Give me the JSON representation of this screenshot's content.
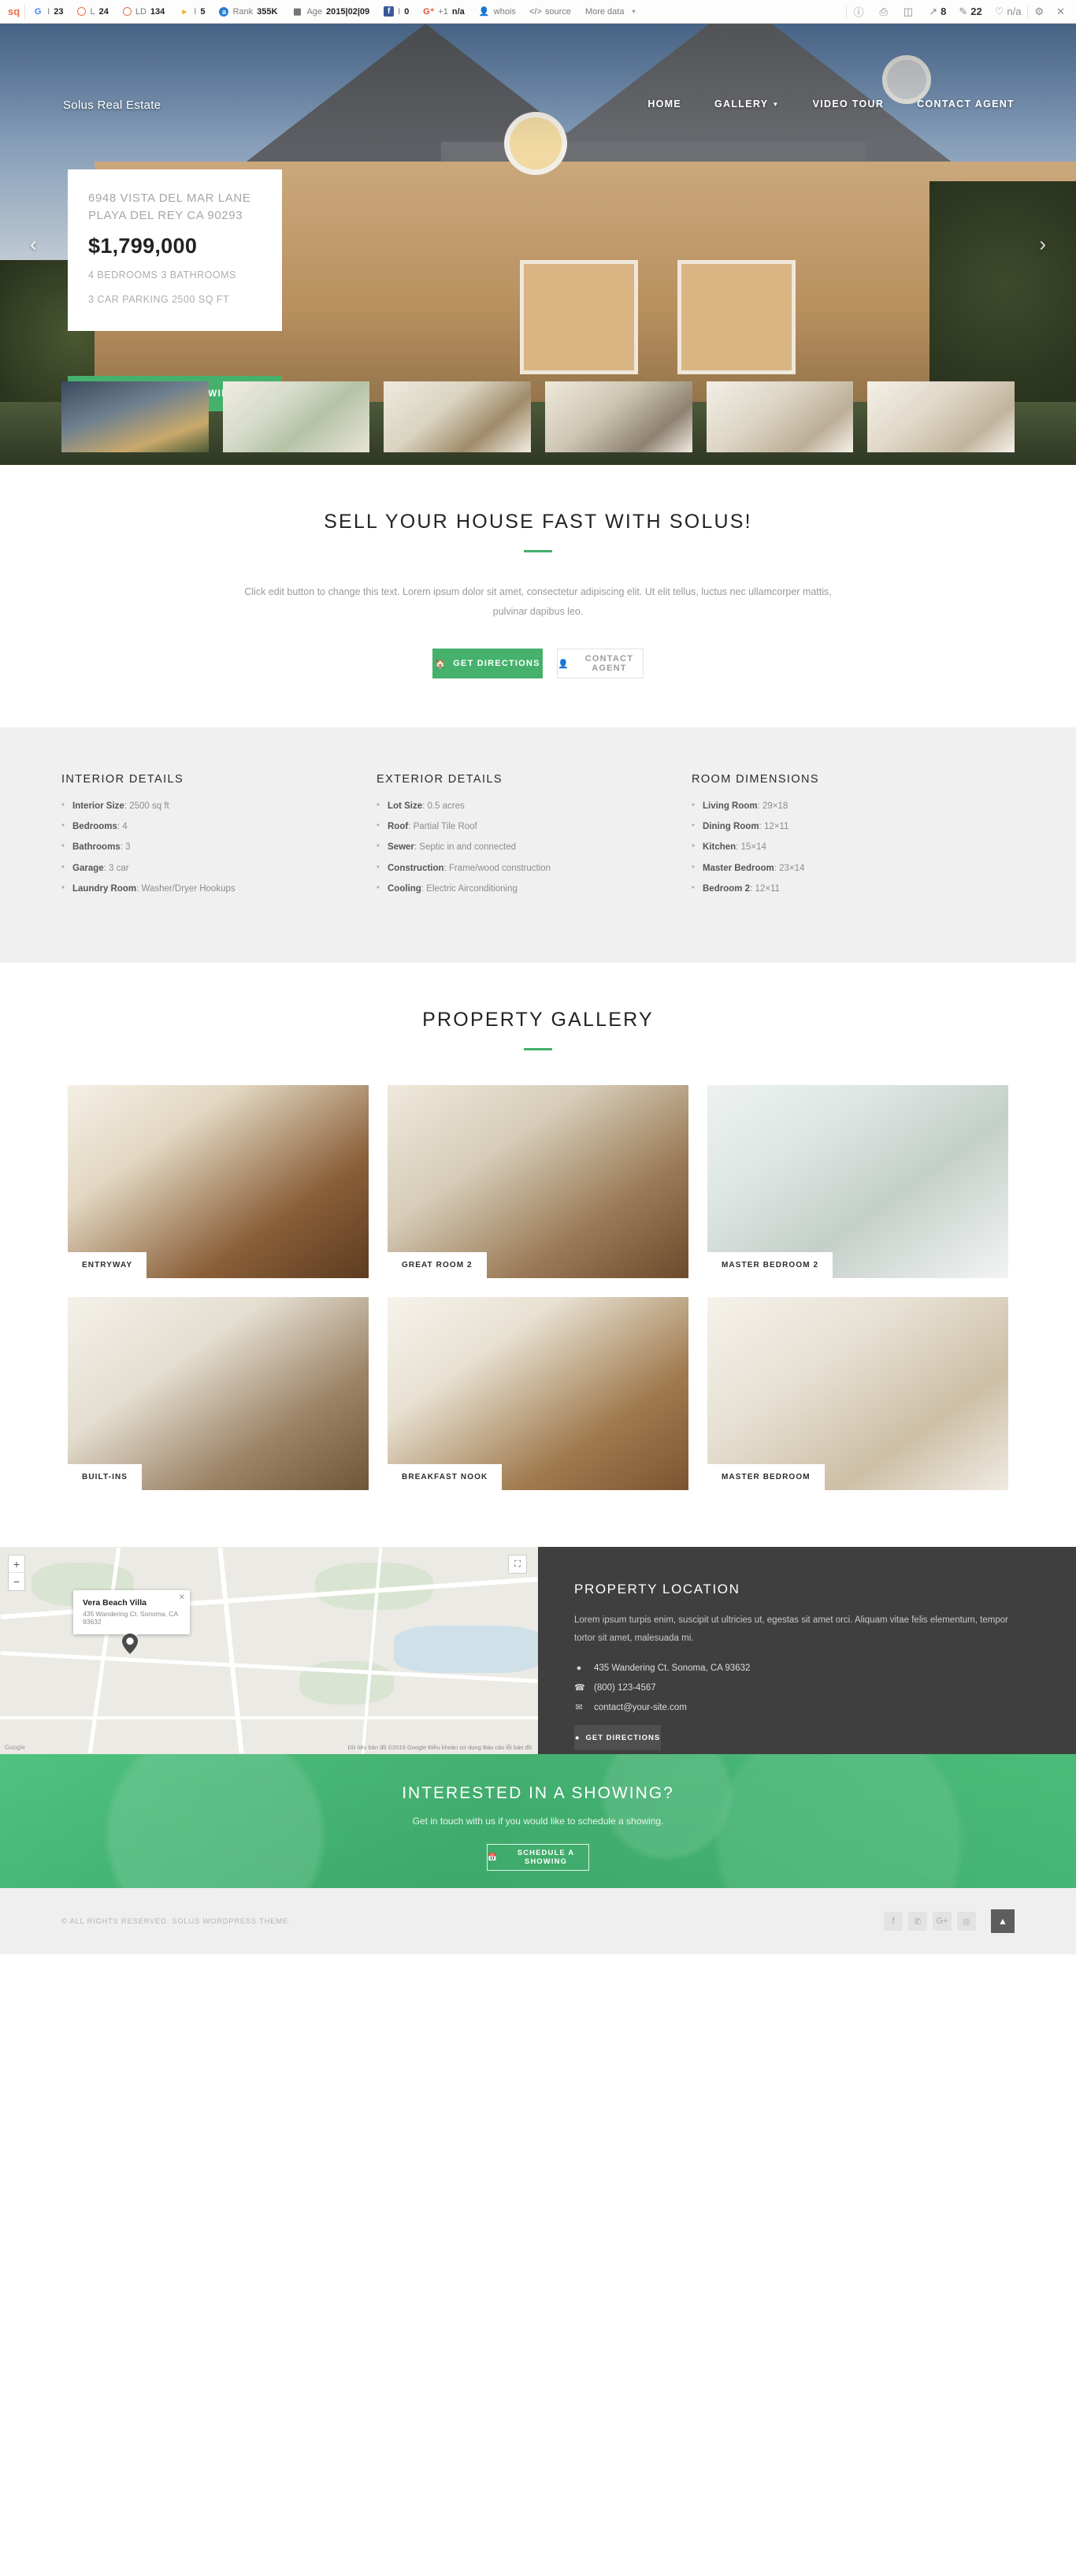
{
  "seobar": {
    "brand": "sq",
    "metrics": [
      {
        "icon": "google-icon",
        "label": "I",
        "value": "23"
      },
      {
        "icon": "moz-icon",
        "label": "L",
        "value": "24"
      },
      {
        "icon": "moz-ld-icon",
        "label": "LD",
        "value": "134"
      },
      {
        "icon": "yandex-icon",
        "label": "I",
        "value": "5"
      },
      {
        "icon": "alexa-icon",
        "label": "Rank",
        "value": "355K"
      },
      {
        "icon": "archive-icon",
        "label": "Age",
        "value": "2015|02|09"
      },
      {
        "icon": "facebook-icon",
        "label": "I",
        "value": "0"
      },
      {
        "icon": "googleplus-icon",
        "label": "+1",
        "value": "n/a"
      }
    ],
    "links": [
      {
        "icon": "person-icon",
        "label": "whois"
      },
      {
        "icon": "code-icon",
        "label": "source"
      },
      {
        "icon": "chevron-down-icon",
        "label": "More data"
      }
    ],
    "right_tools": [
      {
        "icon": "info-icon",
        "value": ""
      },
      {
        "icon": "highlight-icon",
        "value": ""
      },
      {
        "icon": "page-icon",
        "value": ""
      },
      {
        "icon": "external-link-icon",
        "value": "8"
      },
      {
        "icon": "internal-link-icon",
        "value": "22"
      },
      {
        "icon": "health-icon",
        "value": "n/a"
      }
    ],
    "settings_icon": "gear-icon",
    "close_icon": "close-icon"
  },
  "hero": {
    "brand": "Solus Real Estate",
    "nav": [
      {
        "label": "HOME",
        "has_caret": false
      },
      {
        "label": "GALLERY",
        "has_caret": true
      },
      {
        "label": "VIDEO TOUR",
        "has_caret": false
      },
      {
        "label": "CONTACT AGENT",
        "has_caret": false
      }
    ],
    "card": {
      "address_line1": "6948 VISTA DEL MAR LANE",
      "address_line2": "PLAYA DEL REY CA 90293",
      "price": "$1,799,000",
      "specs_line1": "4 BEDROOMS 3 BATHROOMS",
      "specs_line2": "3 CAR PARKING 2500 SQ FT"
    },
    "cta_label": "SCHEDULE A SHOWING",
    "prev_icon": "chevron-left-icon",
    "next_icon": "chevron-right-icon",
    "thumbnails": [
      "thumb-exterior-night",
      "thumb-dining-room",
      "thumb-kitchen-dining",
      "thumb-living-room",
      "thumb-bedroom",
      "thumb-sitting-room"
    ]
  },
  "sell": {
    "title": "SELL YOUR HOUSE FAST WITH SOLUS!",
    "body": "Click edit button to change this text. Lorem ipsum dolor sit amet, consectetur adipiscing elit. Ut elit tellus, luctus nec ullamcorper mattis, pulvinar dapibus leo.",
    "btn_primary": "GET DIRECTIONS",
    "btn_primary_icon": "home-icon",
    "btn_secondary": "CONTACT AGENT",
    "btn_secondary_icon": "user-icon"
  },
  "details": {
    "columns": [
      {
        "title": "INTERIOR DETAILS",
        "items": [
          {
            "label": "Interior Size",
            "value": "2500 sq ft"
          },
          {
            "label": "Bedrooms",
            "value": "4"
          },
          {
            "label": "Bathrooms",
            "value": "3"
          },
          {
            "label": "Garage",
            "value": "3 car"
          },
          {
            "label": "Laundry Room",
            "value": "Washer/Dryer Hookups"
          }
        ]
      },
      {
        "title": "EXTERIOR DETAILS",
        "items": [
          {
            "label": "Lot Size",
            "value": "0.5 acres"
          },
          {
            "label": "Roof",
            "value": "Partial Tile Roof"
          },
          {
            "label": "Sewer",
            "value": "Septic in and connected"
          },
          {
            "label": "Construction",
            "value": "Frame/wood construction"
          },
          {
            "label": "Cooling",
            "value": "Electric Airconditioning"
          }
        ]
      },
      {
        "title": "ROOM DIMENSIONS",
        "items": [
          {
            "label": "Living Room",
            "value": "29×18"
          },
          {
            "label": "Dining Room",
            "value": "12×11"
          },
          {
            "label": "Kitchen",
            "value": "15×14"
          },
          {
            "label": "Master Bedroom",
            "value": "23×14"
          },
          {
            "label": "Bedroom 2",
            "value": "12×11"
          }
        ]
      }
    ]
  },
  "gallery": {
    "title": "PROPERTY GALLERY",
    "items": [
      {
        "caption": "ENTRYWAY"
      },
      {
        "caption": "GREAT ROOM 2"
      },
      {
        "caption": "MASTER BEDROOM 2"
      },
      {
        "caption": "BUILT-INS"
      },
      {
        "caption": "BREAKFAST NOOK"
      },
      {
        "caption": "MASTER BEDROOM"
      }
    ]
  },
  "map": {
    "zoom_in": "+",
    "zoom_out": "−",
    "fullscreen_icon": "fullscreen-icon",
    "infowindow": {
      "title": "Vera Beach Villa",
      "address": "435 Wandering Ct. Sonoma, CA 93632",
      "close_icon": "close-icon"
    },
    "marker_icon": "map-pin-icon",
    "attribution": "Google",
    "terms": "Dữ liệu bản đồ ©2019 Google   Điều khoản sử dụng   Báo cáo lỗi bản đồ"
  },
  "location": {
    "title": "PROPERTY LOCATION",
    "body": "Lorem ipsum turpis enim, suscipit ut ultricies ut, egestas sit amet orci. Aliquam vitae felis elementum, tempor tortor sit amet, malesuada mi.",
    "contacts": [
      {
        "icon": "map-pin-icon",
        "text": "435 Wandering Ct. Sonoma, CA 93632"
      },
      {
        "icon": "phone-icon",
        "text": "(800) 123-4567"
      },
      {
        "icon": "mail-icon",
        "text": "contact@your-site.com"
      }
    ],
    "btn_label": "GET DIRECTIONS",
    "btn_icon": "map-pin-icon"
  },
  "cta": {
    "title": "INTERESTED IN A SHOWING?",
    "subtitle": "Get in touch with us if you would like to schedule a showing.",
    "btn_label": "SCHEDULE A SHOWING",
    "btn_icon": "calendar-icon"
  },
  "footer": {
    "copyright": "© ALL RIGHTS RESERVED. SOLUS WORDPRESS THEME.",
    "social": [
      {
        "icon": "facebook-icon",
        "glyph": "f"
      },
      {
        "icon": "twitter-icon",
        "glyph": "✆"
      },
      {
        "icon": "googleplus-icon",
        "glyph": "G+"
      },
      {
        "icon": "instagram-icon",
        "glyph": "◎"
      }
    ],
    "to_top_icon": "chevron-up-icon",
    "to_top_glyph": "▲"
  },
  "colors": {
    "accent_green": "#45b16c",
    "dark_panel": "#3f3f3f",
    "light_panel": "#f0f0f0",
    "footer_bg": "#efefef"
  }
}
